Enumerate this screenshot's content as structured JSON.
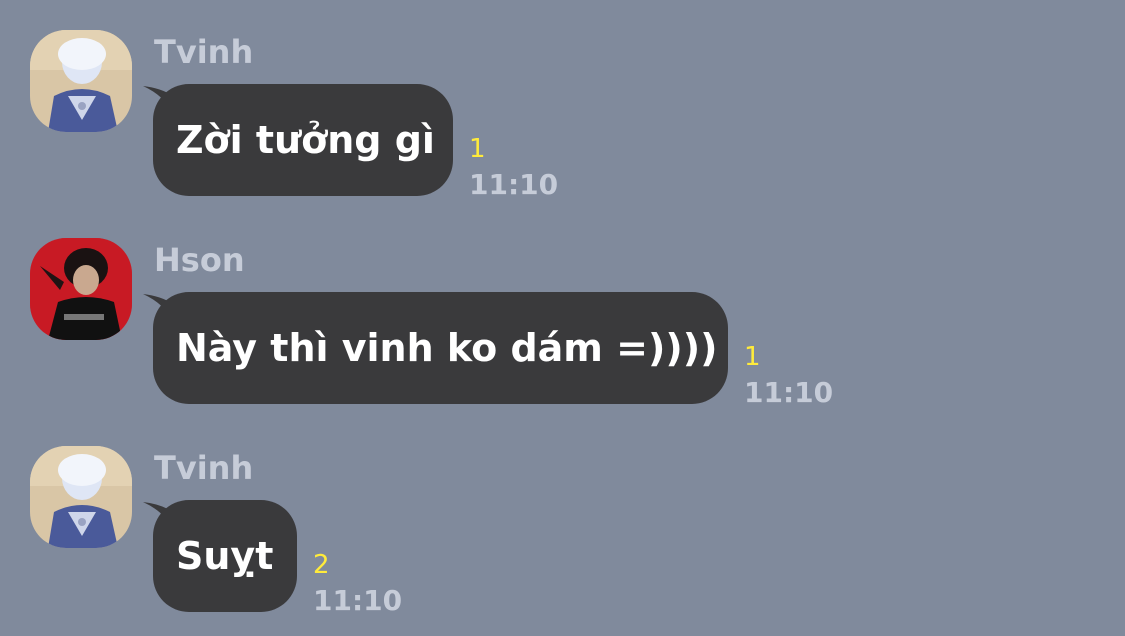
{
  "messages": [
    {
      "sender": "Tvinh",
      "avatar_icon": "user-avatar-icon",
      "text": "Zời tưởng gì",
      "unread": "1",
      "time": "11:10"
    },
    {
      "sender": "Hson",
      "avatar_icon": "user-avatar-icon",
      "text": "Này thì vinh ko dám =))))",
      "unread": "1",
      "time": "11:10"
    },
    {
      "sender": "Tvinh",
      "avatar_icon": "user-avatar-icon",
      "text": "Suỵt",
      "unread": "2",
      "time": "11:10"
    }
  ],
  "colors": {
    "background": "#808a9c",
    "bubble": "#3a3a3c",
    "unread": "#ffeb3b",
    "meta_text": "#c6ccd8"
  }
}
